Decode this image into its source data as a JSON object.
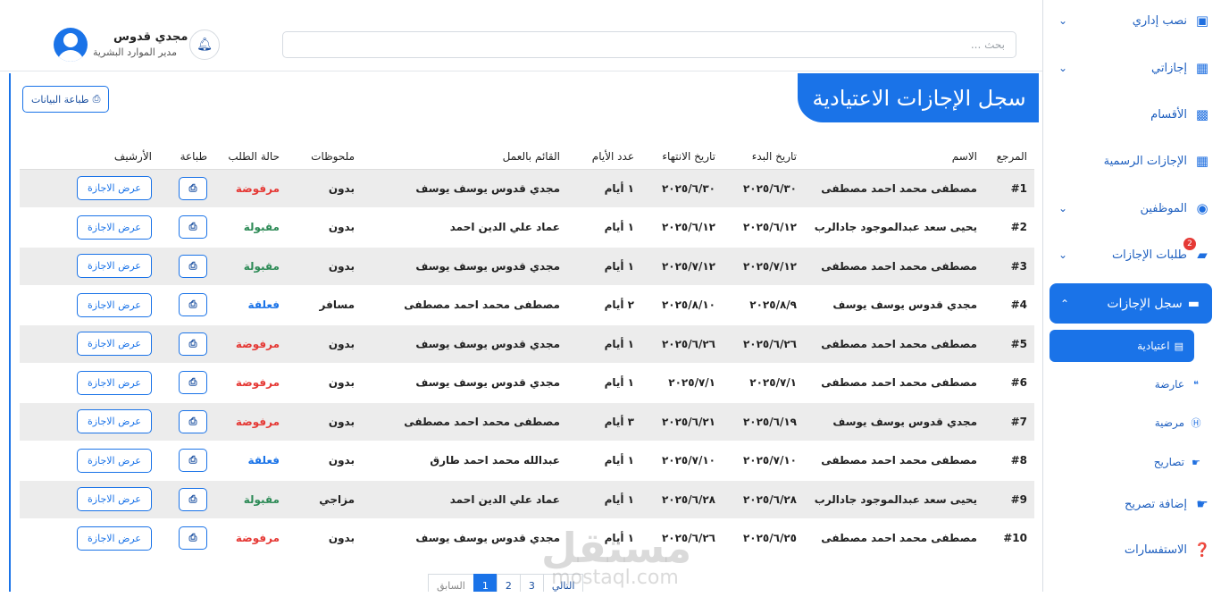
{
  "topbar": {
    "search_placeholder": "بحث ...",
    "user_name": "مجدي قدوس",
    "user_role": "مدير الموارد البشرية"
  },
  "sidebar": {
    "items": [
      {
        "label": "نصب إداري",
        "icon": "plus-square-icon"
      },
      {
        "label": "إجازاتي",
        "icon": "calendar-icon"
      },
      {
        "label": "الأقسام",
        "icon": "users-card-icon"
      },
      {
        "label": "الإجازات الرسمية",
        "icon": "calendar-check-icon"
      },
      {
        "label": "الموظفين",
        "icon": "users-icon"
      },
      {
        "label": "طلبات الإجازات",
        "icon": "folder-open-icon",
        "badge": "2"
      },
      {
        "label": "سجل الإجازات",
        "icon": "folder-icon"
      },
      {
        "label": "إضافة تصريح",
        "icon": "add-permit-icon"
      },
      {
        "label": "الاستفسارات",
        "icon": "question-icon"
      }
    ],
    "sub_items": [
      {
        "label": "اعتيادية",
        "icon": "list-icon"
      },
      {
        "label": "عارضة",
        "icon": "quote-icon"
      },
      {
        "label": "مرضية",
        "icon": "hospital-icon"
      },
      {
        "label": "تصاريح",
        "icon": "permit-icon"
      }
    ]
  },
  "page": {
    "title": "سجل الإجازات الاعتيادية",
    "print_label": "طباعة البيانات"
  },
  "table": {
    "headers": [
      "المرجع",
      "الاسم",
      "تاريخ البدء",
      "تاريخ الانتهاء",
      "عدد الأيام",
      "القائم بالعمل",
      "ملحوظات",
      "حالة الطلب",
      "طباعة",
      "الأرشيف"
    ],
    "view_label": "عرض الاجازة",
    "rows": [
      {
        "ref": "#1",
        "name": "مصطفى محمد احمد مصطفى",
        "start": "٢٠٢٥/٦/٣٠",
        "end": "٢٠٢٥/٦/٣٠",
        "days": "١ أيام",
        "substitute": "مجدي قدوس يوسف يوسف",
        "notes": "بدون",
        "status": "مرفوضة",
        "status_type": "rejected"
      },
      {
        "ref": "#2",
        "name": "يحيى سعد عبدالموجود جادالرب",
        "start": "٢٠٢٥/٦/١٢",
        "end": "٢٠٢٥/٦/١٢",
        "days": "١ أيام",
        "substitute": "عماد علي الدين احمد",
        "notes": "بدون",
        "status": "مقبولة",
        "status_type": "accepted"
      },
      {
        "ref": "#3",
        "name": "مصطفى محمد احمد مصطفى",
        "start": "٢٠٢٥/٧/١٢",
        "end": "٢٠٢٥/٧/١٢",
        "days": "١ أيام",
        "substitute": "مجدي قدوس يوسف يوسف",
        "notes": "بدون",
        "status": "مقبولة",
        "status_type": "accepted"
      },
      {
        "ref": "#4",
        "name": "مجدي قدوس يوسف يوسف",
        "start": "٢٠٢٥/٨/٩",
        "end": "٢٠٢٥/٨/١٠",
        "days": "٢ أيام",
        "substitute": "مصطفى محمد احمد مصطفى",
        "notes": "مسافر",
        "status": "فعلقة",
        "status_type": "pending"
      },
      {
        "ref": "#5",
        "name": "مصطفى محمد احمد مصطفى",
        "start": "٢٠٢٥/٦/٢٦",
        "end": "٢٠٢٥/٦/٢٦",
        "days": "١ أيام",
        "substitute": "مجدي قدوس يوسف يوسف",
        "notes": "بدون",
        "status": "مرفوضة",
        "status_type": "rejected"
      },
      {
        "ref": "#6",
        "name": "مصطفى محمد احمد مصطفى",
        "start": "٢٠٢٥/٧/١",
        "end": "٢٠٢٥/٧/١",
        "days": "١ أيام",
        "substitute": "مجدي قدوس يوسف يوسف",
        "notes": "بدون",
        "status": "مرفوضة",
        "status_type": "rejected"
      },
      {
        "ref": "#7",
        "name": "مجدي قدوس يوسف يوسف",
        "start": "٢٠٢٥/٦/١٩",
        "end": "٢٠٢٥/٦/٢١",
        "days": "٣ أيام",
        "substitute": "مصطفى محمد احمد مصطفى",
        "notes": "بدون",
        "status": "مرفوضة",
        "status_type": "rejected"
      },
      {
        "ref": "#8",
        "name": "مصطفى محمد احمد مصطفى",
        "start": "٢٠٢٥/٧/١٠",
        "end": "٢٠٢٥/٧/١٠",
        "days": "١ أيام",
        "substitute": "عبدالله محمد احمد طارق",
        "notes": "بدون",
        "status": "فعلقة",
        "status_type": "pending"
      },
      {
        "ref": "#9",
        "name": "يحيى سعد عبدالموجود جادالرب",
        "start": "٢٠٢٥/٦/٢٨",
        "end": "٢٠٢٥/٦/٢٨",
        "days": "١ أيام",
        "substitute": "عماد علي الدين احمد",
        "notes": "مزاجي",
        "status": "مقبولة",
        "status_type": "accepted"
      },
      {
        "ref": "#10",
        "name": "مصطفى محمد احمد مصطفى",
        "start": "٢٠٢٥/٦/٢٥",
        "end": "٢٠٢٥/٦/٢٦",
        "days": "١ أيام",
        "substitute": "مجدي قدوس يوسف يوسف",
        "notes": "بدون",
        "status": "مرفوضة",
        "status_type": "rejected"
      }
    ]
  },
  "pagination": {
    "prev": "السابق",
    "pages": [
      "1",
      "2",
      "3"
    ],
    "next": "التالي"
  },
  "watermark": {
    "arabic": "مستقل",
    "latin": "mostaql.com"
  },
  "colors": {
    "primary": "#1a73e8",
    "rejected": "#e53935",
    "accepted": "#2e8b57",
    "pending": "#1a73e8"
  }
}
